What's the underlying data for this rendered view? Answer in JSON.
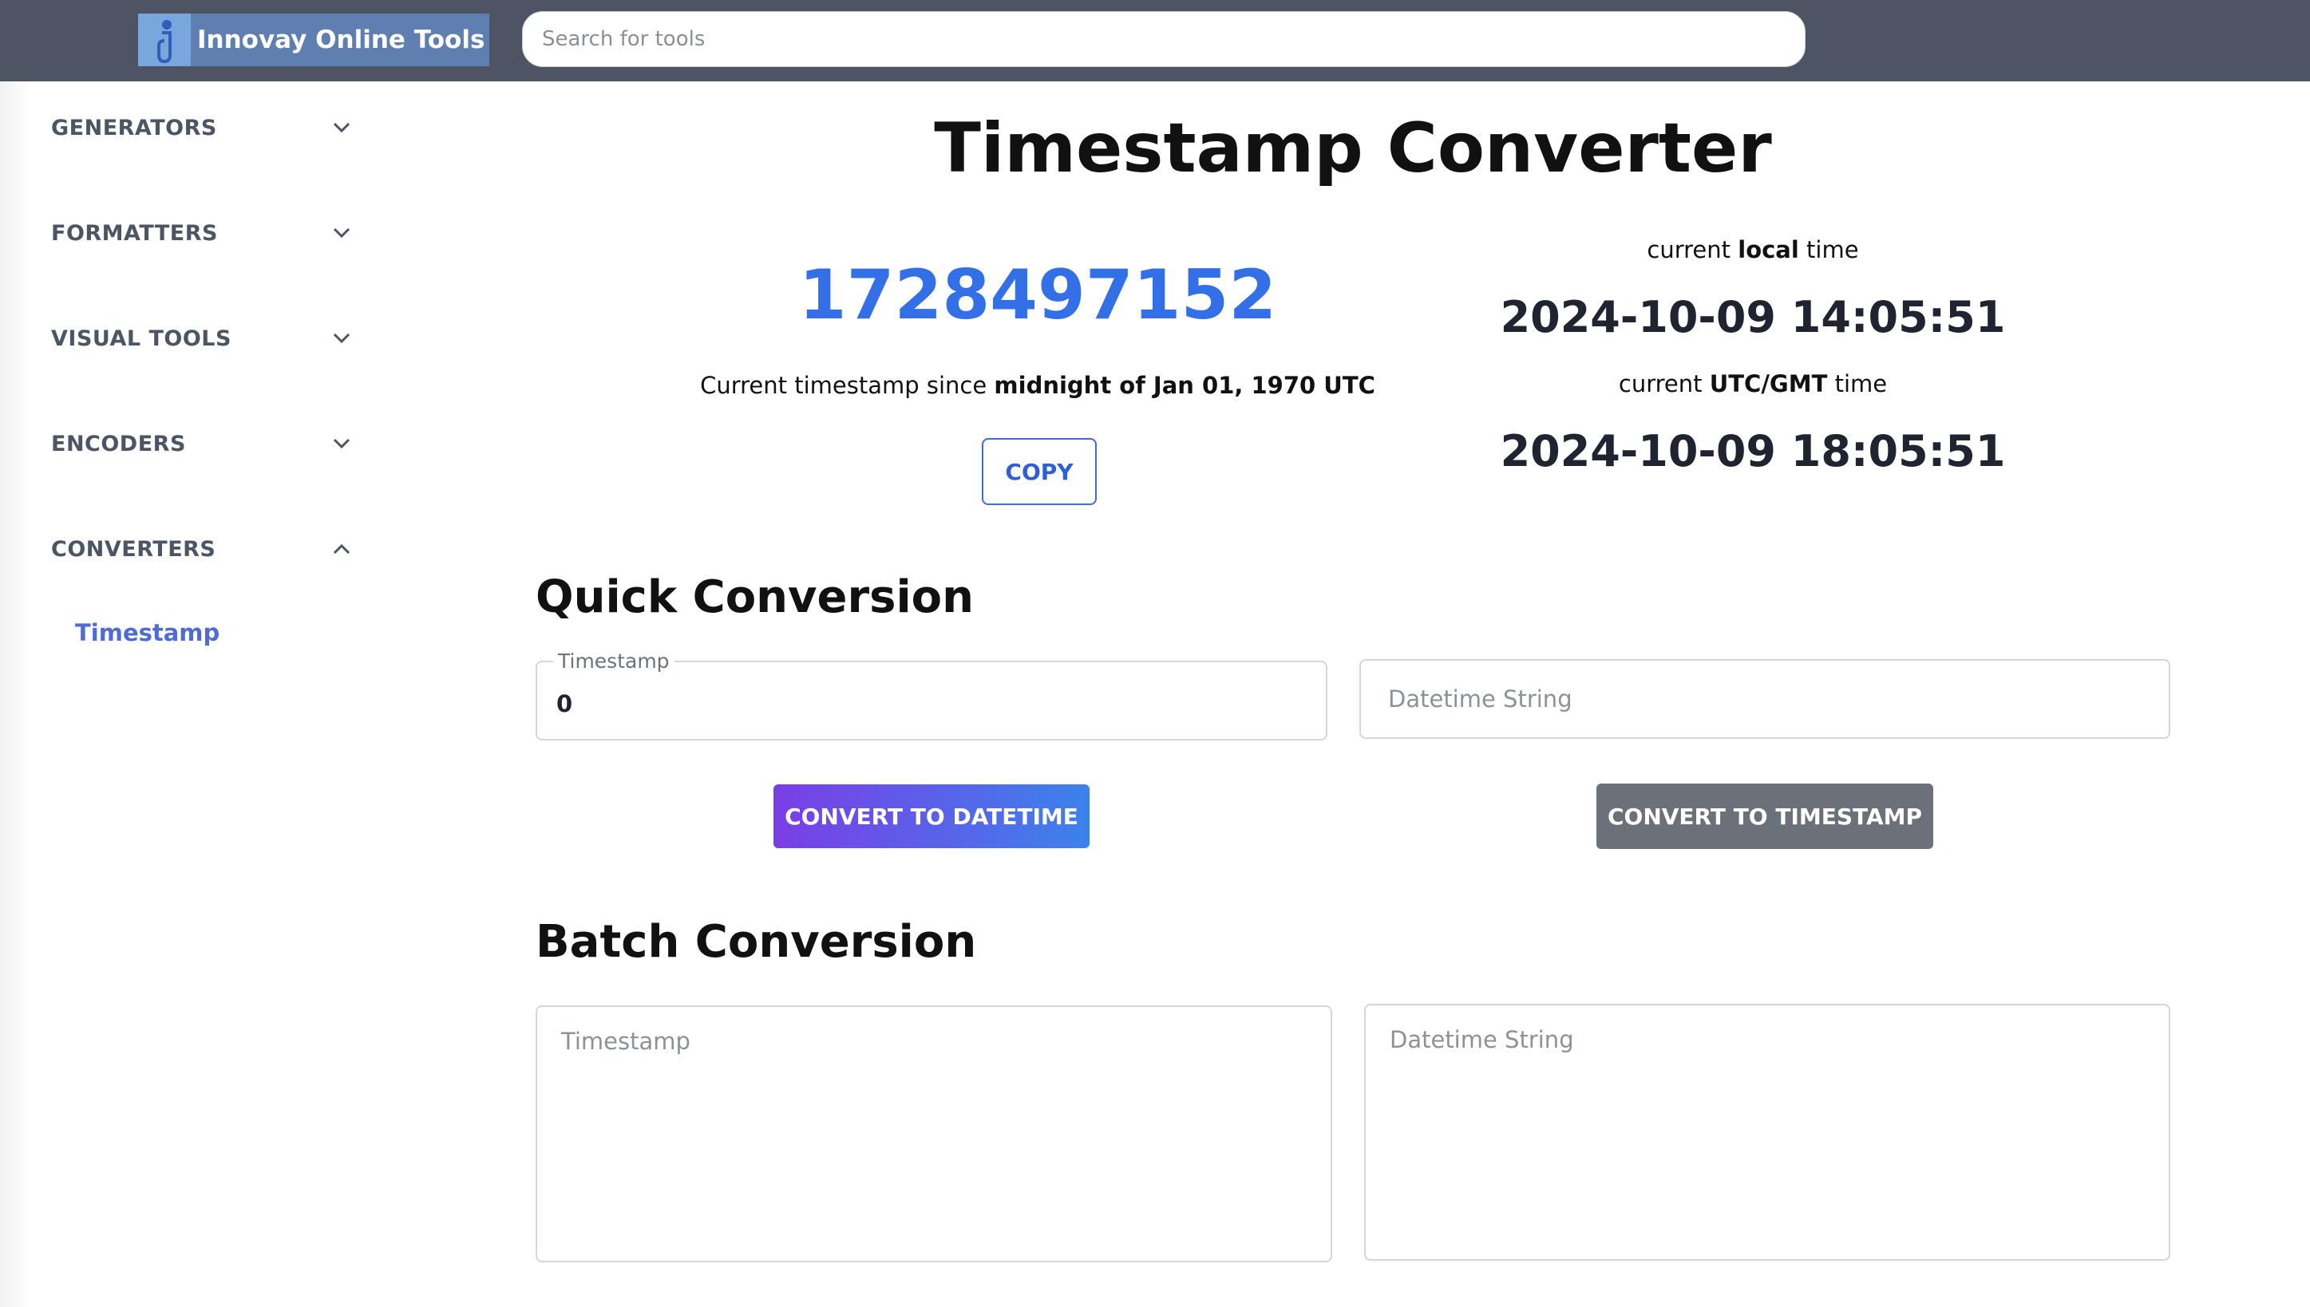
{
  "header": {
    "brand": "Innovay Online Tools",
    "logo_icon": "innovay-logo-icon",
    "search_placeholder": "Search for tools"
  },
  "sidebar": {
    "items": [
      {
        "label": "GENERATORS",
        "icon": "chevron-down-icon"
      },
      {
        "label": "FORMATTERS",
        "icon": "chevron-down-icon"
      },
      {
        "label": "VISUAL TOOLS",
        "icon": "chevron-down-icon"
      },
      {
        "label": "ENCODERS",
        "icon": "chevron-down-icon"
      },
      {
        "label": "CONVERTERS",
        "icon": "chevron-up-icon"
      }
    ],
    "active_subitem": "Timestamp"
  },
  "main": {
    "title": "Timestamp Converter",
    "current_timestamp": "1728497152",
    "caption_prefix": "Current timestamp since ",
    "caption_bold": "midnight of Jan 01, 1970 UTC",
    "copy_label": "COPY",
    "local_label_pre": "current ",
    "local_label_bold": "local",
    "local_label_post": " time",
    "local_time": "2024-10-09 14:05:51",
    "utc_label_pre": "current ",
    "utc_label_bold": "UTC/GMT",
    "utc_label_post": " time",
    "utc_time": "2024-10-09 18:05:51",
    "quick_title": "Quick Conversion",
    "quick_timestamp_label": "Timestamp",
    "quick_timestamp_value": "0",
    "quick_datetime_placeholder": "Datetime String",
    "convert_to_datetime": "CONVERT TO DATETIME",
    "convert_to_timestamp": "CONVERT TO TIMESTAMP",
    "batch_title": "Batch Conversion",
    "batch_timestamp_placeholder": "Timestamp",
    "batch_datetime_placeholder": "Datetime String"
  },
  "colors": {
    "topbar": "#4d5564",
    "accent_blue": "#3370e8",
    "sidebar_active": "#4f6bd8",
    "button_gray": "#6b7079"
  }
}
